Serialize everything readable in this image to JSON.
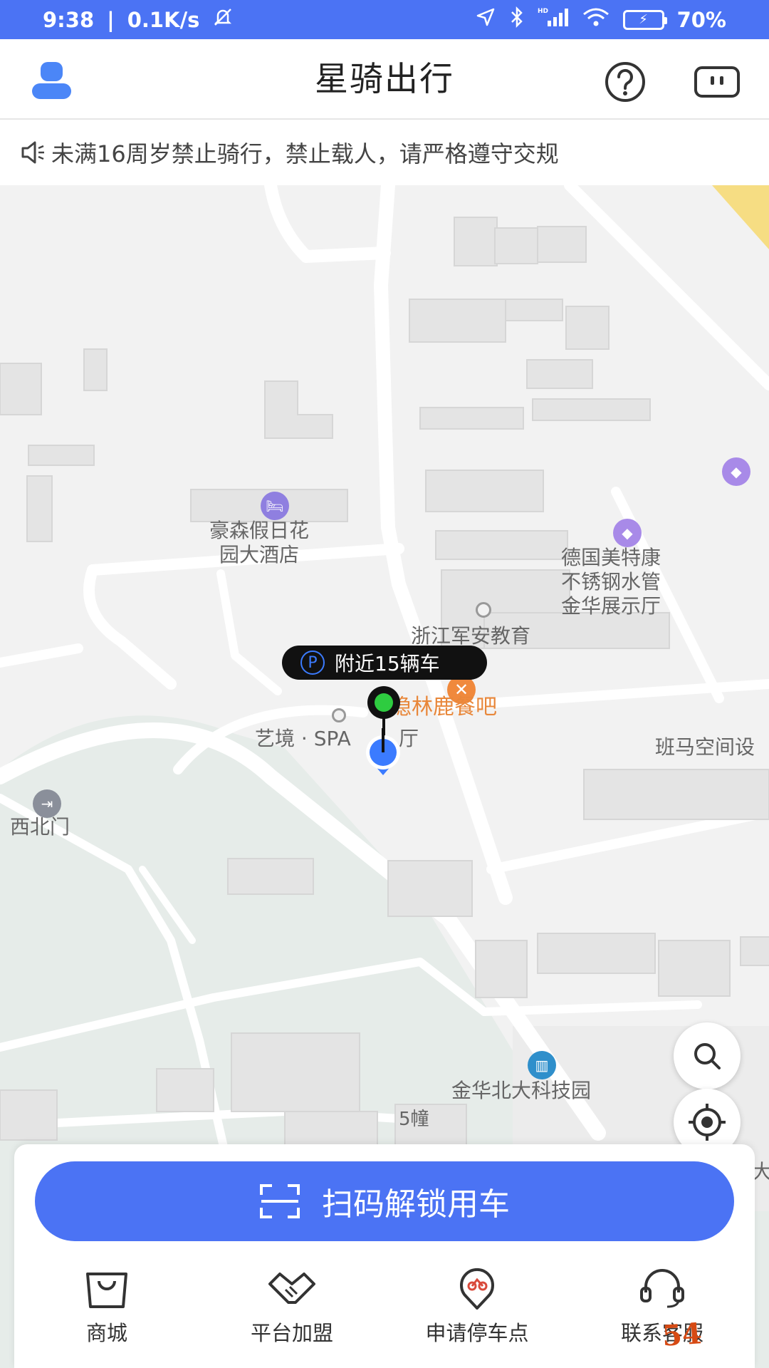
{
  "status_bar": {
    "time": "9:38",
    "network_speed": "0.1K/s",
    "icons": [
      "mute-bell-icon",
      "location-arrow-icon",
      "bluetooth-icon",
      "hd-signal-icon",
      "wifi-icon"
    ],
    "battery": "70%",
    "battery_level_percent": 70
  },
  "header": {
    "title": "星骑出行",
    "left_icon": "user-profile-icon",
    "right_icons": [
      "help-icon",
      "message-icon"
    ]
  },
  "notice": {
    "text": "未满16周岁禁止骑行，禁止载人，请严格遵守交规",
    "icon": "speaker-icon"
  },
  "map": {
    "labels": {
      "hotel": "豪森假日花\n园大酒店",
      "showroom": "德国美特康\n不锈钢水管\n金华展示厅",
      "education": "浙江军安教育",
      "restaurant": "隐林鹿餐吧",
      "spa": "艺境 · SPA",
      "spa_suffix": "厅",
      "banma": "班马空间设",
      "northwest_gate": "西北门",
      "tech_park": "金华北大科技园",
      "building_5": "5幢",
      "edge_char": "大"
    },
    "nearby_bubble": "附近15辆车"
  },
  "controls": {
    "mode_toggle": [
      "bike-mode-icon",
      "parking-mode-icon"
    ],
    "active_mode": "bike",
    "search_icon": "search-icon",
    "locate_icon": "locate-icon"
  },
  "bottom_panel": {
    "scan_button_label": "扫码解锁用车",
    "nav": [
      {
        "label": "商城",
        "icon": "shopping-bag-icon"
      },
      {
        "label": "平台加盟",
        "icon": "handshake-icon"
      },
      {
        "label": "申请停车点",
        "icon": "parking-point-icon"
      },
      {
        "label": "联系客服",
        "icon": "headset-icon"
      }
    ]
  },
  "watermark": "54"
}
